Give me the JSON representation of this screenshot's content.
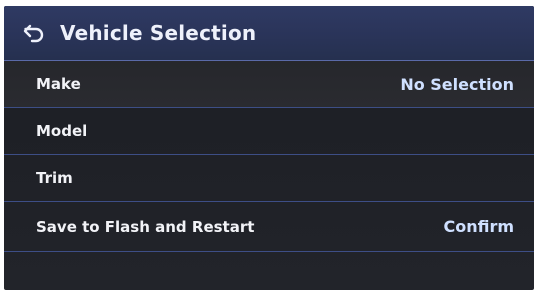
{
  "header": {
    "title": "Vehicle Selection",
    "back_icon": "back-arrow-icon"
  },
  "rows": [
    {
      "label": "Make",
      "value": "No Selection"
    },
    {
      "label": "Model",
      "value": ""
    },
    {
      "label": "Trim",
      "value": ""
    },
    {
      "label": "Save to Flash and Restart",
      "value": "Confirm"
    }
  ],
  "colors": {
    "header_bg": "#2a3459",
    "divider": "#3d4e86",
    "value_text": "#cfe0ff"
  }
}
